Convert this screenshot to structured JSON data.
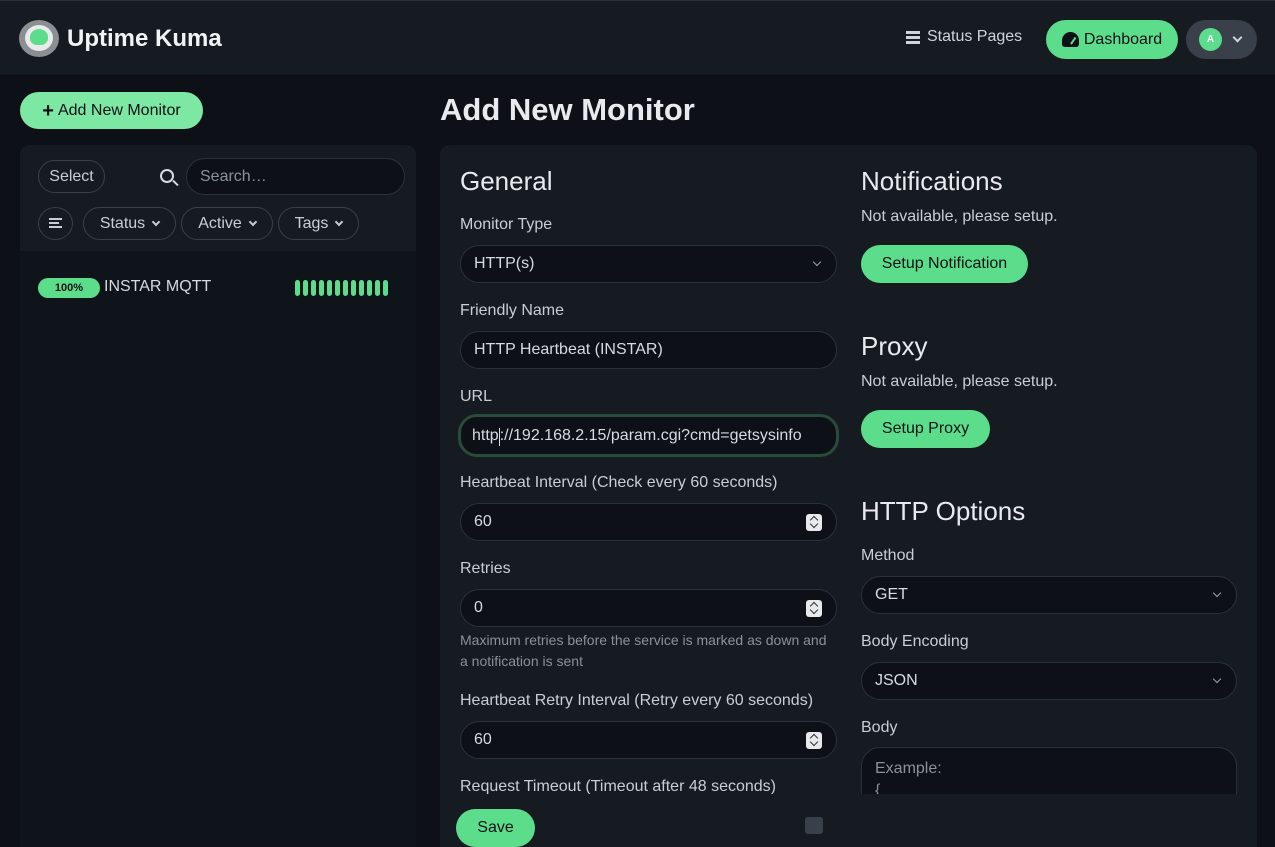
{
  "header": {
    "brand": "Uptime Kuma",
    "status_pages": "Status Pages",
    "dashboard": "Dashboard",
    "avatar_initial": "A",
    "accent": "#5cdd8b"
  },
  "sidebar": {
    "add_button": "Add New Monitor",
    "select_button": "Select",
    "search_placeholder": "Search…",
    "filters": {
      "status": "Status",
      "active": "Active",
      "tags": "Tags"
    },
    "monitors": [
      {
        "uptime": "100%",
        "name": "INSTAR MQTT",
        "beats": 12
      }
    ]
  },
  "page": {
    "title": "Add New Monitor"
  },
  "general": {
    "heading": "General",
    "monitor_type_label": "Monitor Type",
    "monitor_type_value": "HTTP(s)",
    "friendly_name_label": "Friendly Name",
    "friendly_name_value": "HTTP Heartbeat (INSTAR)",
    "url_label": "URL",
    "url_value_before_caret": "http",
    "url_value_after_caret": "://192.168.2.15/param.cgi?cmd=getsysinfo",
    "interval_label": "Heartbeat Interval (Check every 60 seconds)",
    "interval_value": "60",
    "retries_label": "Retries",
    "retries_value": "0",
    "retries_help": "Maximum retries before the service is marked as down and a notification is sent",
    "retry_interval_label": "Heartbeat Retry Interval (Retry every 60 seconds)",
    "retry_interval_value": "60",
    "timeout_label": "Request Timeout (Timeout after 48 seconds)"
  },
  "notifications": {
    "heading": "Notifications",
    "message": "Not available, please setup.",
    "button": "Setup Notification"
  },
  "proxy": {
    "heading": "Proxy",
    "message": "Not available, please setup.",
    "button": "Setup Proxy"
  },
  "http_options": {
    "heading": "HTTP Options",
    "method_label": "Method",
    "method_value": "GET",
    "encoding_label": "Body Encoding",
    "encoding_value": "JSON",
    "body_label": "Body",
    "body_placeholder": "Example:\n{\n    \"key\": \"value\"\n}"
  },
  "footer": {
    "save": "Save"
  }
}
